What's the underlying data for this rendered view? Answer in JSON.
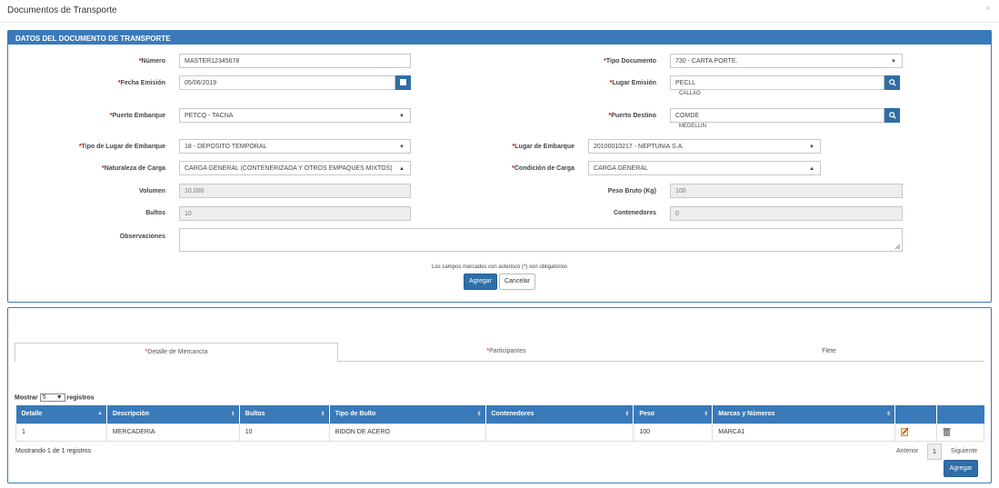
{
  "window": {
    "title": "Documentos de Transporte",
    "close": "×"
  },
  "doc_panel": {
    "header": "DATOS DEL DOCUMENTO DE TRANSPORTE",
    "fields": {
      "numero": {
        "label": "Número",
        "value": "MASTER12345678"
      },
      "tipo_documento": {
        "label": "Tipo Documento",
        "value": "730 - CARTA PORTE."
      },
      "fecha_emision": {
        "label": "Fecha Emisión",
        "value": "05/06/2019"
      },
      "lugar_emision": {
        "label": "Lugar Emisión",
        "value": "PECLL",
        "sub": "CALLAO"
      },
      "puerto_embarque": {
        "label": "Puerto Embarque",
        "value": "PETCQ - TACNA"
      },
      "puerto_destino": {
        "label": "Puerto Destino",
        "value": "COMDE",
        "sub": "MEDELLIN"
      },
      "tipo_lugar_embarque": {
        "label": "Tipo de Lugar de Embarque",
        "value": "18 - DEPOSITO TEMPORAL"
      },
      "lugar_embarque": {
        "label": "Lugar de Embarque",
        "value": "20100010217 - NEPTUNIA S.A."
      },
      "naturaleza_carga": {
        "label": "Naturaleza de Carga",
        "value": "CARGA GENERAL (CONTENERIZADA Y OTROS EMPAQUES MIXTOS)"
      },
      "condicion_carga": {
        "label": "Condición de Carga",
        "value": "CARGA GENERAL"
      },
      "volumen": {
        "label": "Volumen",
        "value": "10.000"
      },
      "peso_bruto": {
        "label": "Peso Bruto (Kg)",
        "value": "100"
      },
      "bultos": {
        "label": "Bultos",
        "value": "10"
      },
      "contenedores": {
        "label": "Contenedores",
        "value": "0"
      },
      "observaciones": {
        "label": "Observaciones",
        "value": ""
      }
    },
    "note": "Los campos marcados con asterisco (*) son obligatorios",
    "buttons": {
      "agregar": "Agregar",
      "cancelar": "Cancelar"
    }
  },
  "detail_panel": {
    "tabs": [
      {
        "label": "Detalle de Mercancía",
        "required": true,
        "active": true
      },
      {
        "label": "Participantes",
        "required": true,
        "active": false
      },
      {
        "label": "Flete",
        "required": false,
        "active": false
      }
    ],
    "show": {
      "prefix": "Mostrar",
      "value": "5",
      "suffix": "registros"
    },
    "columns": [
      "Detalle",
      "Descripción",
      "Bultos",
      "Tipo de Bulto",
      "Contenedores",
      "Peso",
      "Marcas y Números",
      "",
      ""
    ],
    "rows": [
      [
        "1",
        "MERCADERIA",
        "10",
        "BIDON DE ACERO",
        "",
        "100",
        "MARCA1"
      ]
    ],
    "info": "Mostrando 1 de 1 registros",
    "pager": {
      "prev": "Anterior",
      "page": "1",
      "next": "Siguiente"
    },
    "add_button": "Agregar"
  },
  "icons": {
    "calendar": "calendar-icon",
    "search": "search-icon",
    "edit": "edit-icon",
    "delete": "trash-icon"
  },
  "colors": {
    "primary": "#3a7ab8",
    "required": "#dd0000"
  }
}
